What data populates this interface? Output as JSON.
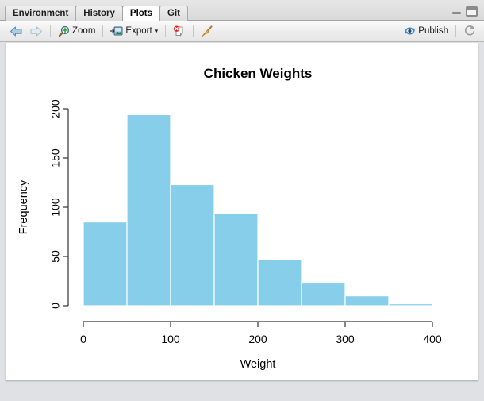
{
  "window": {
    "minimize_label": "Minimize",
    "maximize_label": "Maximize"
  },
  "tabs": [
    {
      "label": "Environment",
      "active": false
    },
    {
      "label": "History",
      "active": false
    },
    {
      "label": "Plots",
      "active": true
    },
    {
      "label": "Git",
      "active": false
    }
  ],
  "toolbar": {
    "back_icon": "back-arrow-icon",
    "forward_icon": "forward-arrow-icon",
    "zoom_label": "Zoom",
    "zoom_icon": "magnifier-icon",
    "export_label": "Export",
    "export_caret": "▾",
    "export_icon": "export-image-icon",
    "remove_label": "Remove current plot",
    "remove_icon": "remove-plot-icon",
    "clear_label": "Clear all plots",
    "clear_icon": "broom-icon",
    "publish_label": "Publish",
    "publish_icon": "publish-icon",
    "refresh_label": "Refresh",
    "refresh_icon": "refresh-icon"
  },
  "colors": {
    "bar_fill": "#87ceeb",
    "axis": "#333333",
    "text": "#000000",
    "panel_bg": "#ffffff",
    "tab_active_bg": "#fdfdfd"
  },
  "chart_data": {
    "type": "bar",
    "title": "Chicken Weights",
    "xlabel": "Weight",
    "ylabel": "Frequency",
    "bin_width": 50,
    "bin_edges": [
      0,
      50,
      100,
      150,
      200,
      250,
      300,
      350,
      400
    ],
    "categories": [
      "0-50",
      "50-100",
      "100-150",
      "150-200",
      "200-250",
      "250-300",
      "300-350",
      "350-400"
    ],
    "values": [
      85,
      194,
      123,
      94,
      47,
      23,
      10,
      2
    ],
    "xticks": [
      0,
      100,
      200,
      300,
      400
    ],
    "xtick_labels": [
      "0",
      "100",
      "200",
      "300",
      "400"
    ],
    "yticks": [
      0,
      50,
      100,
      150,
      200
    ],
    "ytick_labels": [
      "0",
      "50",
      "100",
      "150",
      "200"
    ],
    "xlim": [
      0,
      400
    ],
    "ylim": [
      0,
      200
    ],
    "grid": false,
    "legend": false
  }
}
